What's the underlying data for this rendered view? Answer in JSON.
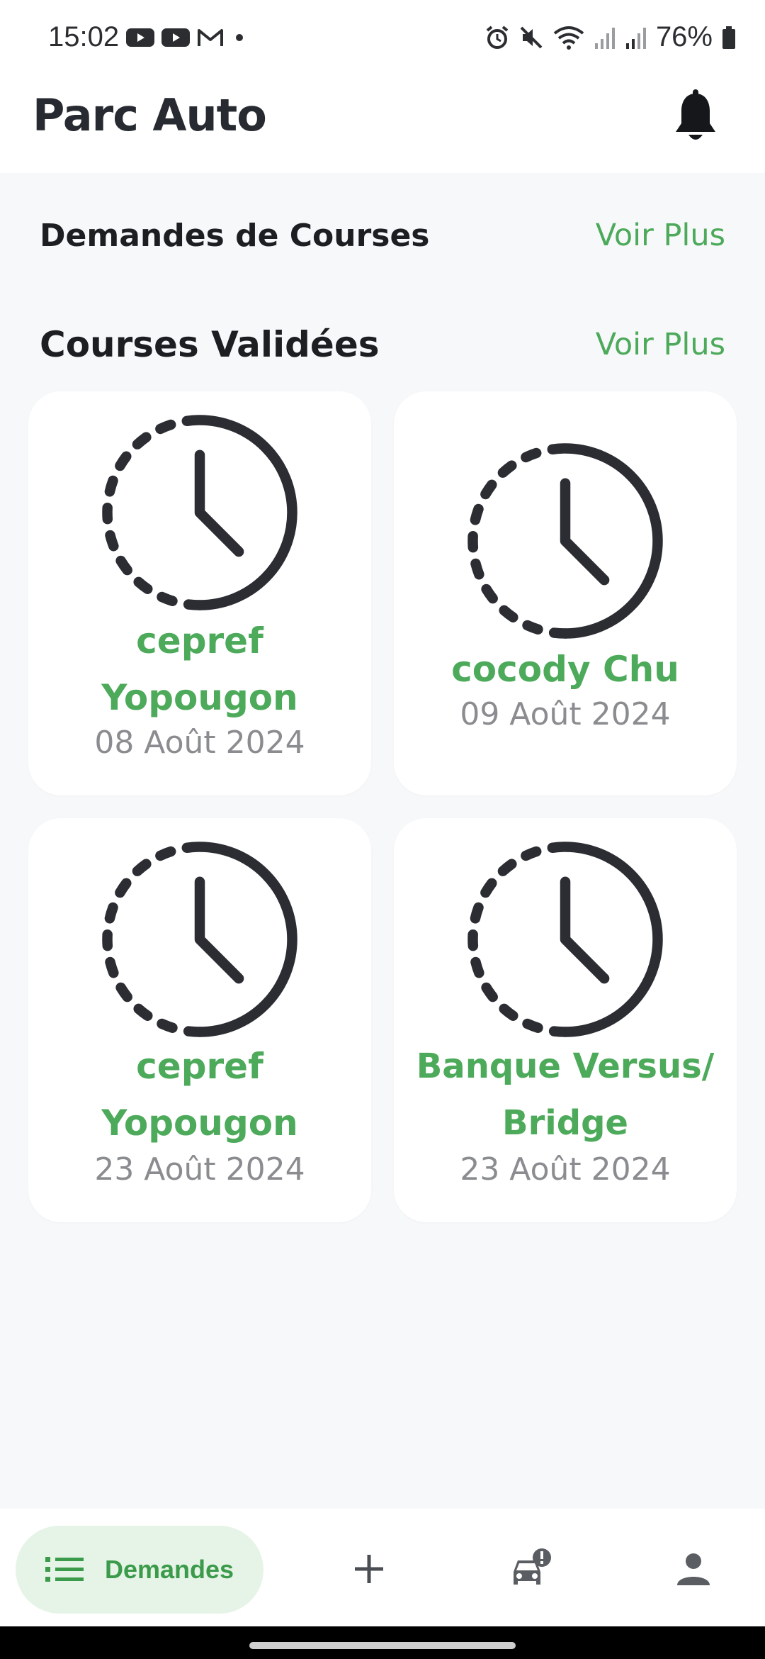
{
  "status_bar": {
    "time": "15:02",
    "battery": "76%",
    "icons": [
      "youtube-icon",
      "youtube-icon",
      "gmail-icon",
      "dot-icon",
      "alarm-icon",
      "mute-icon",
      "wifi-icon",
      "signal-icon",
      "signal-icon",
      "battery-icon"
    ]
  },
  "app_bar": {
    "title": "Parc Auto",
    "icon": "bell-icon"
  },
  "sections": {
    "requests": {
      "title": "Demandes de Courses",
      "link": "Voir Plus"
    },
    "validated": {
      "title": "Courses Validées",
      "link": "Voir Plus"
    }
  },
  "cards": [
    {
      "title": "cepref Yopougon",
      "date": "08 Août 2024",
      "icon": "clock-icon"
    },
    {
      "title": "cocody Chu",
      "date": "09 Août 2024",
      "icon": "clock-icon"
    },
    {
      "title": "cepref Yopougon",
      "date": "23 Août 2024",
      "icon": "clock-icon"
    },
    {
      "title": "Banque Versus/ Bridge",
      "date": "23 Août 2024",
      "icon": "clock-icon"
    }
  ],
  "bottom_nav": {
    "active_label": "Demandes",
    "items": [
      "list-icon",
      "plus-icon",
      "car-alert-icon",
      "person-icon"
    ]
  },
  "colors": {
    "accent": "#4caa5a",
    "background": "#f7f8fa",
    "card": "#ffffff",
    "pill": "#e6f4e7",
    "text_dark": "#22252b",
    "text_muted": "#8a8c90"
  }
}
